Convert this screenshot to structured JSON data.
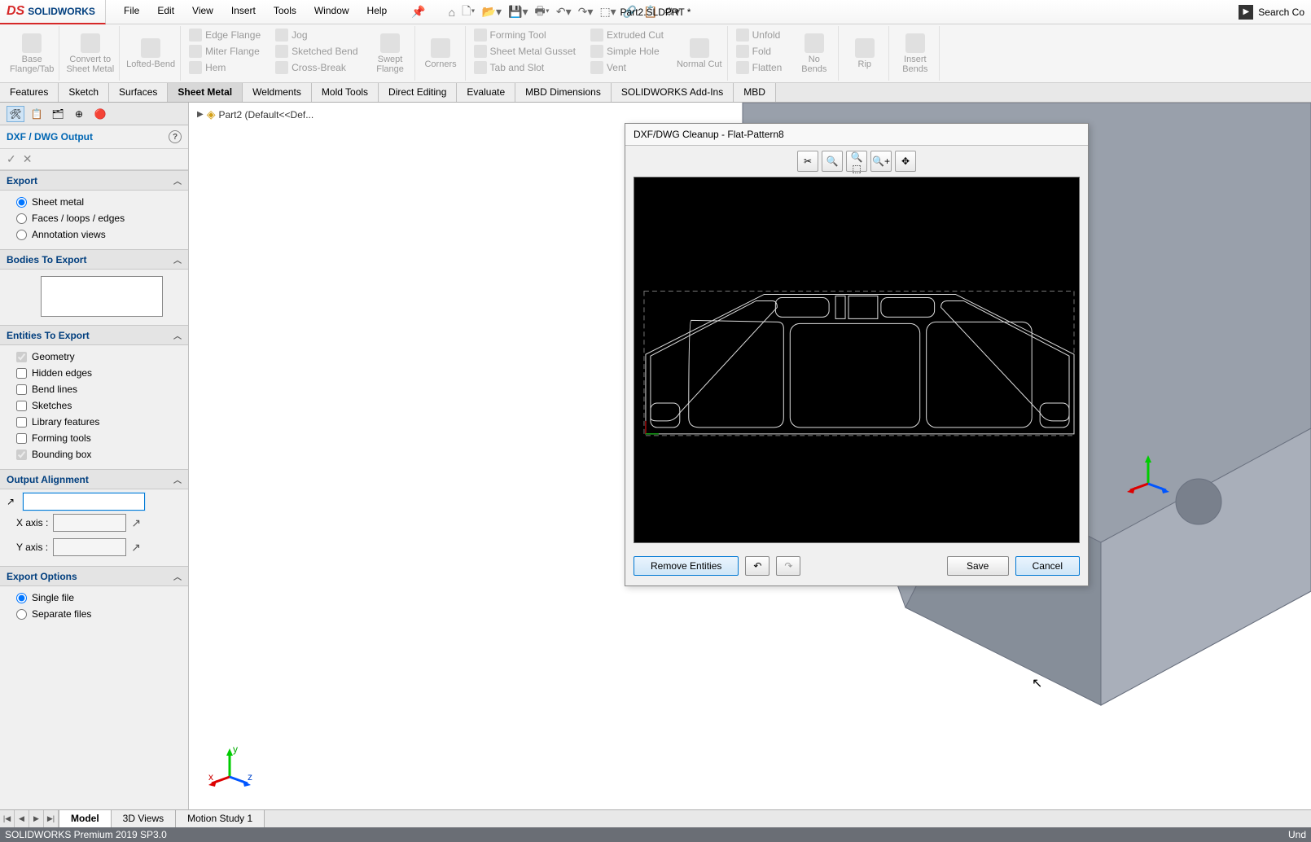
{
  "app": {
    "name": "SOLIDWORKS",
    "doc_title": "Part2.SLDPRT *",
    "search_placeholder": "Search Co"
  },
  "menu": {
    "file": "File",
    "edit": "Edit",
    "view": "View",
    "insert": "Insert",
    "tools": "Tools",
    "window": "Window",
    "help": "Help"
  },
  "ribbon": {
    "base": "Base\nFlange/Tab",
    "convert": "Convert to\nSheet Metal",
    "lofted": "Lofted-Bend",
    "edge": "Edge Flange",
    "miter": "Miter Flange",
    "hem": "Hem",
    "jog": "Jog",
    "sketched": "Sketched Bend",
    "cross": "Cross-Break",
    "swept": "Swept\nFlange",
    "corners": "Corners",
    "forming": "Forming Tool",
    "gusset": "Sheet Metal Gusset",
    "tab": "Tab and Slot",
    "extruded": "Extruded Cut",
    "simple": "Simple Hole",
    "vent": "Vent",
    "normal": "Normal Cut",
    "unfold": "Unfold",
    "fold": "Fold",
    "flatten": "Flatten",
    "nobends": "No\nBends",
    "rip": "Rip",
    "insertbends": "Insert\nBends"
  },
  "tabs": {
    "features": "Features",
    "sketch": "Sketch",
    "surfaces": "Surfaces",
    "sheetmetal": "Sheet Metal",
    "weldments": "Weldments",
    "mold": "Mold Tools",
    "direct": "Direct Editing",
    "evaluate": "Evaluate",
    "mbddim": "MBD Dimensions",
    "addins": "SOLIDWORKS Add-Ins",
    "mbd": "MBD"
  },
  "breadcrumb": {
    "part": "Part2  (Default<<Def..."
  },
  "panel": {
    "title": "DXF / DWG Output",
    "export_hdr": "Export",
    "sheet_metal": "Sheet metal",
    "faces": "Faces / loops / edges",
    "annotation": "Annotation views",
    "bodies_hdr": "Bodies To Export",
    "entities_hdr": "Entities To Export",
    "geometry": "Geometry",
    "hidden": "Hidden edges",
    "bend": "Bend lines",
    "sketches": "Sketches",
    "library": "Library features",
    "formingtools": "Forming tools",
    "bounding": "Bounding box",
    "align_hdr": "Output Alignment",
    "xaxis": "X axis :",
    "yaxis": "Y axis :",
    "options_hdr": "Export Options",
    "single": "Single file",
    "separate": "Separate files"
  },
  "dialog": {
    "title": "DXF/DWG Cleanup - Flat-Pattern8",
    "remove": "Remove Entities",
    "save": "Save",
    "cancel": "Cancel"
  },
  "bottom": {
    "model": "Model",
    "views3d": "3D Views",
    "motion": "Motion Study 1"
  },
  "status": {
    "left": "SOLIDWORKS Premium 2019 SP3.0",
    "right": "Und"
  }
}
